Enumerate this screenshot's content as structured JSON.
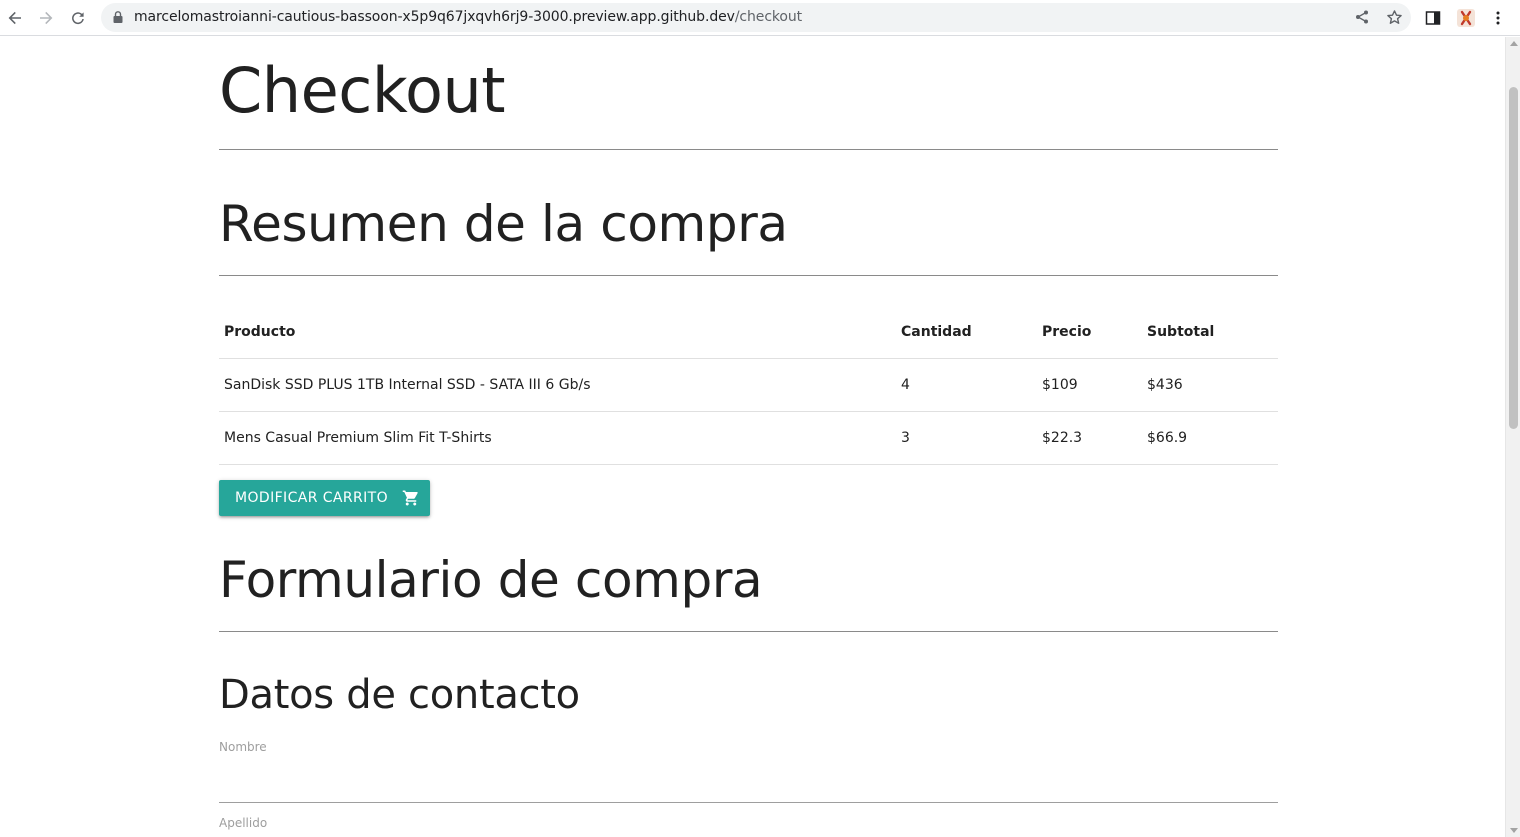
{
  "browser": {
    "url_host": "marcelomastroianni-cautious-bassoon-x5p9q67jxqvh6rj9-3000.preview.app.github.dev",
    "url_path": "/checkout"
  },
  "page": {
    "title": "Checkout",
    "summary_heading": "Resumen de la compra",
    "table": {
      "headers": {
        "product": "Producto",
        "quantity": "Cantidad",
        "price": "Precio",
        "subtotal": "Subtotal"
      },
      "rows": [
        {
          "product": "SanDisk SSD PLUS 1TB Internal SSD - SATA III 6 Gb/s",
          "quantity": "4",
          "price": "$109",
          "subtotal": "$436"
        },
        {
          "product": "Mens Casual Premium Slim Fit T-Shirts",
          "quantity": "3",
          "price": "$22.3",
          "subtotal": "$66.9"
        }
      ]
    },
    "modify_cart_label": "Modificar carrito",
    "form_heading": "Formulario de compra",
    "contact_heading": "Datos de contacto",
    "fields": {
      "first_name_label": "Nombre",
      "first_name_value": "",
      "last_name_label": "Apellido"
    }
  },
  "colors": {
    "accent": "#26a69a",
    "text": "#212121",
    "muted": "#9e9e9e"
  },
  "icons": {
    "back": "arrow-left-icon",
    "forward": "arrow-right-icon",
    "reload": "reload-icon",
    "lock": "lock-icon",
    "share": "share-icon",
    "bookmark": "star-icon",
    "side_panel": "side-panel-icon",
    "extension": "extension-icon",
    "menu": "kebab-menu-icon",
    "cart": "shopping-cart-icon"
  }
}
